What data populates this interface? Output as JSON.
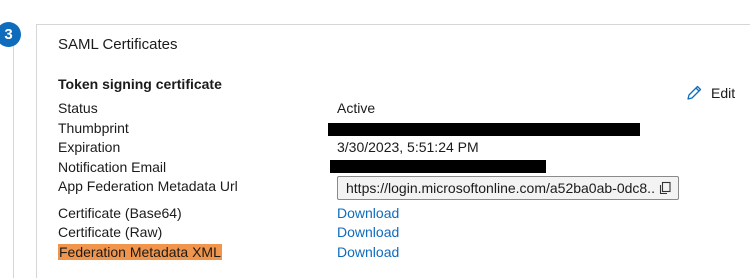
{
  "step": {
    "number": "3"
  },
  "card": {
    "title": "SAML Certificates",
    "section_title": "Token signing certificate",
    "edit_label": "Edit"
  },
  "fields": {
    "status": {
      "label": "Status",
      "value": "Active"
    },
    "thumbprint": {
      "label": "Thumbprint",
      "value": ""
    },
    "expiration": {
      "label": "Expiration",
      "value": "3/30/2023, 5:51:24 PM"
    },
    "notification_email": {
      "label": "Notification Email",
      "value": ""
    },
    "metadata_url": {
      "label": "App Federation Metadata Url",
      "value": "https://login.microsoftonline.com/a52ba0ab-0dc8..."
    },
    "cert_base64": {
      "label": "Certificate (Base64)",
      "action": "Download"
    },
    "cert_raw": {
      "label": "Certificate (Raw)",
      "action": "Download"
    },
    "federation_xml": {
      "label": "Federation Metadata XML",
      "action": "Download"
    }
  },
  "colors": {
    "accent": "#0f6cbd",
    "highlight": "#f0954b",
    "border": "#d6d6d6"
  },
  "icons": {
    "edit": "pencil-icon",
    "copy": "copy-icon"
  }
}
